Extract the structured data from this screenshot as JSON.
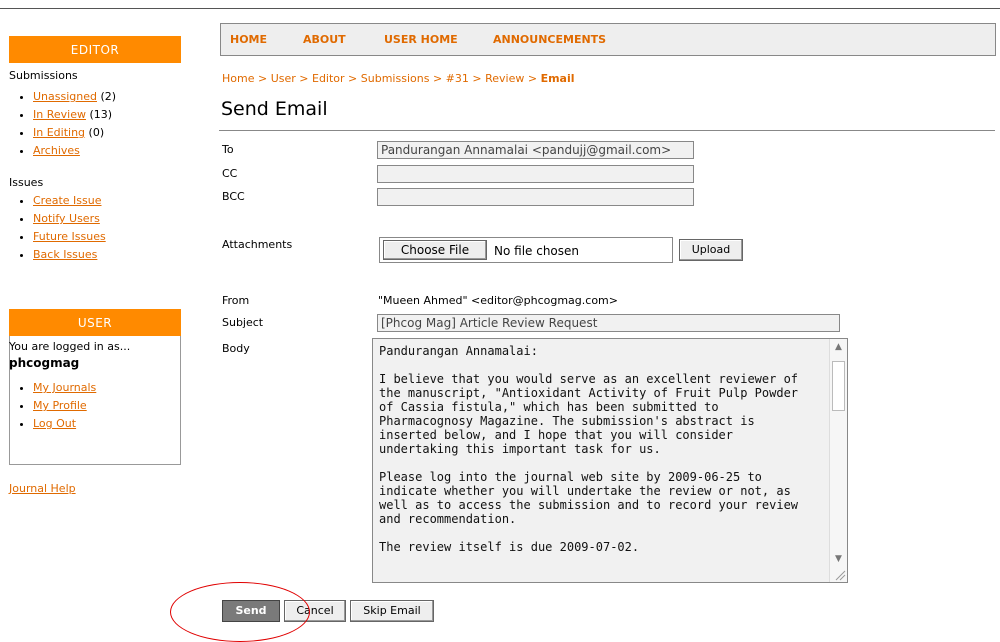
{
  "sidebar": {
    "editor": {
      "heading": "EDITOR",
      "submissions_label": "Submissions",
      "submissions": [
        {
          "label": "Unassigned",
          "count": "(2)"
        },
        {
          "label": "In Review",
          "count": "(13)"
        },
        {
          "label": "In Editing",
          "count": "(0)"
        },
        {
          "label": "Archives",
          "count": ""
        }
      ],
      "issues_label": "Issues",
      "issues": [
        "Create Issue",
        "Notify Users",
        "Future Issues",
        "Back Issues"
      ]
    },
    "user": {
      "heading": "USER",
      "logged_in_as": "You are logged in as...",
      "username": "phcogmag",
      "links": [
        "My Journals",
        "My Profile",
        "Log Out"
      ]
    },
    "journal_help": "Journal Help"
  },
  "nav": [
    "HOME",
    "ABOUT",
    "USER HOME",
    "ANNOUNCEMENTS"
  ],
  "breadcrumb": {
    "items": [
      "Home",
      "User",
      "Editor",
      "Submissions",
      "#31",
      "Review"
    ],
    "separator": " > ",
    "current": "Email"
  },
  "page_title": "Send Email",
  "form": {
    "to_label": "To",
    "to_value": "Pandurangan Annamalai <pandujj@gmail.com>",
    "cc_label": "CC",
    "cc_value": "",
    "bcc_label": "BCC",
    "bcc_value": "",
    "attachments_label": "Attachments",
    "choose_file": "Choose File",
    "no_file": "No file chosen",
    "upload": "Upload",
    "from_label": "From",
    "from_value": "\"Mueen Ahmed\" <editor@phcogmag.com>",
    "subject_label": "Subject",
    "subject_value": "[Phcog Mag] Article Review Request",
    "body_label": "Body",
    "body_value": "Pandurangan Annamalai:\n\nI believe that you would serve as an excellent reviewer of the manuscript, \"Antioxidant Activity of Fruit Pulp Powder of Cassia fistula,\" which has been submitted to Pharmacognosy Magazine. The submission's abstract is inserted below, and I hope that you will consider undertaking this important task for us.\n\nPlease log into the journal web site by 2009-06-25 to indicate whether you will undertake the review or not, as well as to access the submission and to record your review and recommendation.\n\nThe review itself is due 2009-07-02."
  },
  "actions": {
    "send": "Send",
    "cancel": "Cancel",
    "skip": "Skip Email"
  },
  "colors": {
    "accent": "#ff8a00",
    "link": "#e06a00",
    "annotation": "#e00000"
  }
}
